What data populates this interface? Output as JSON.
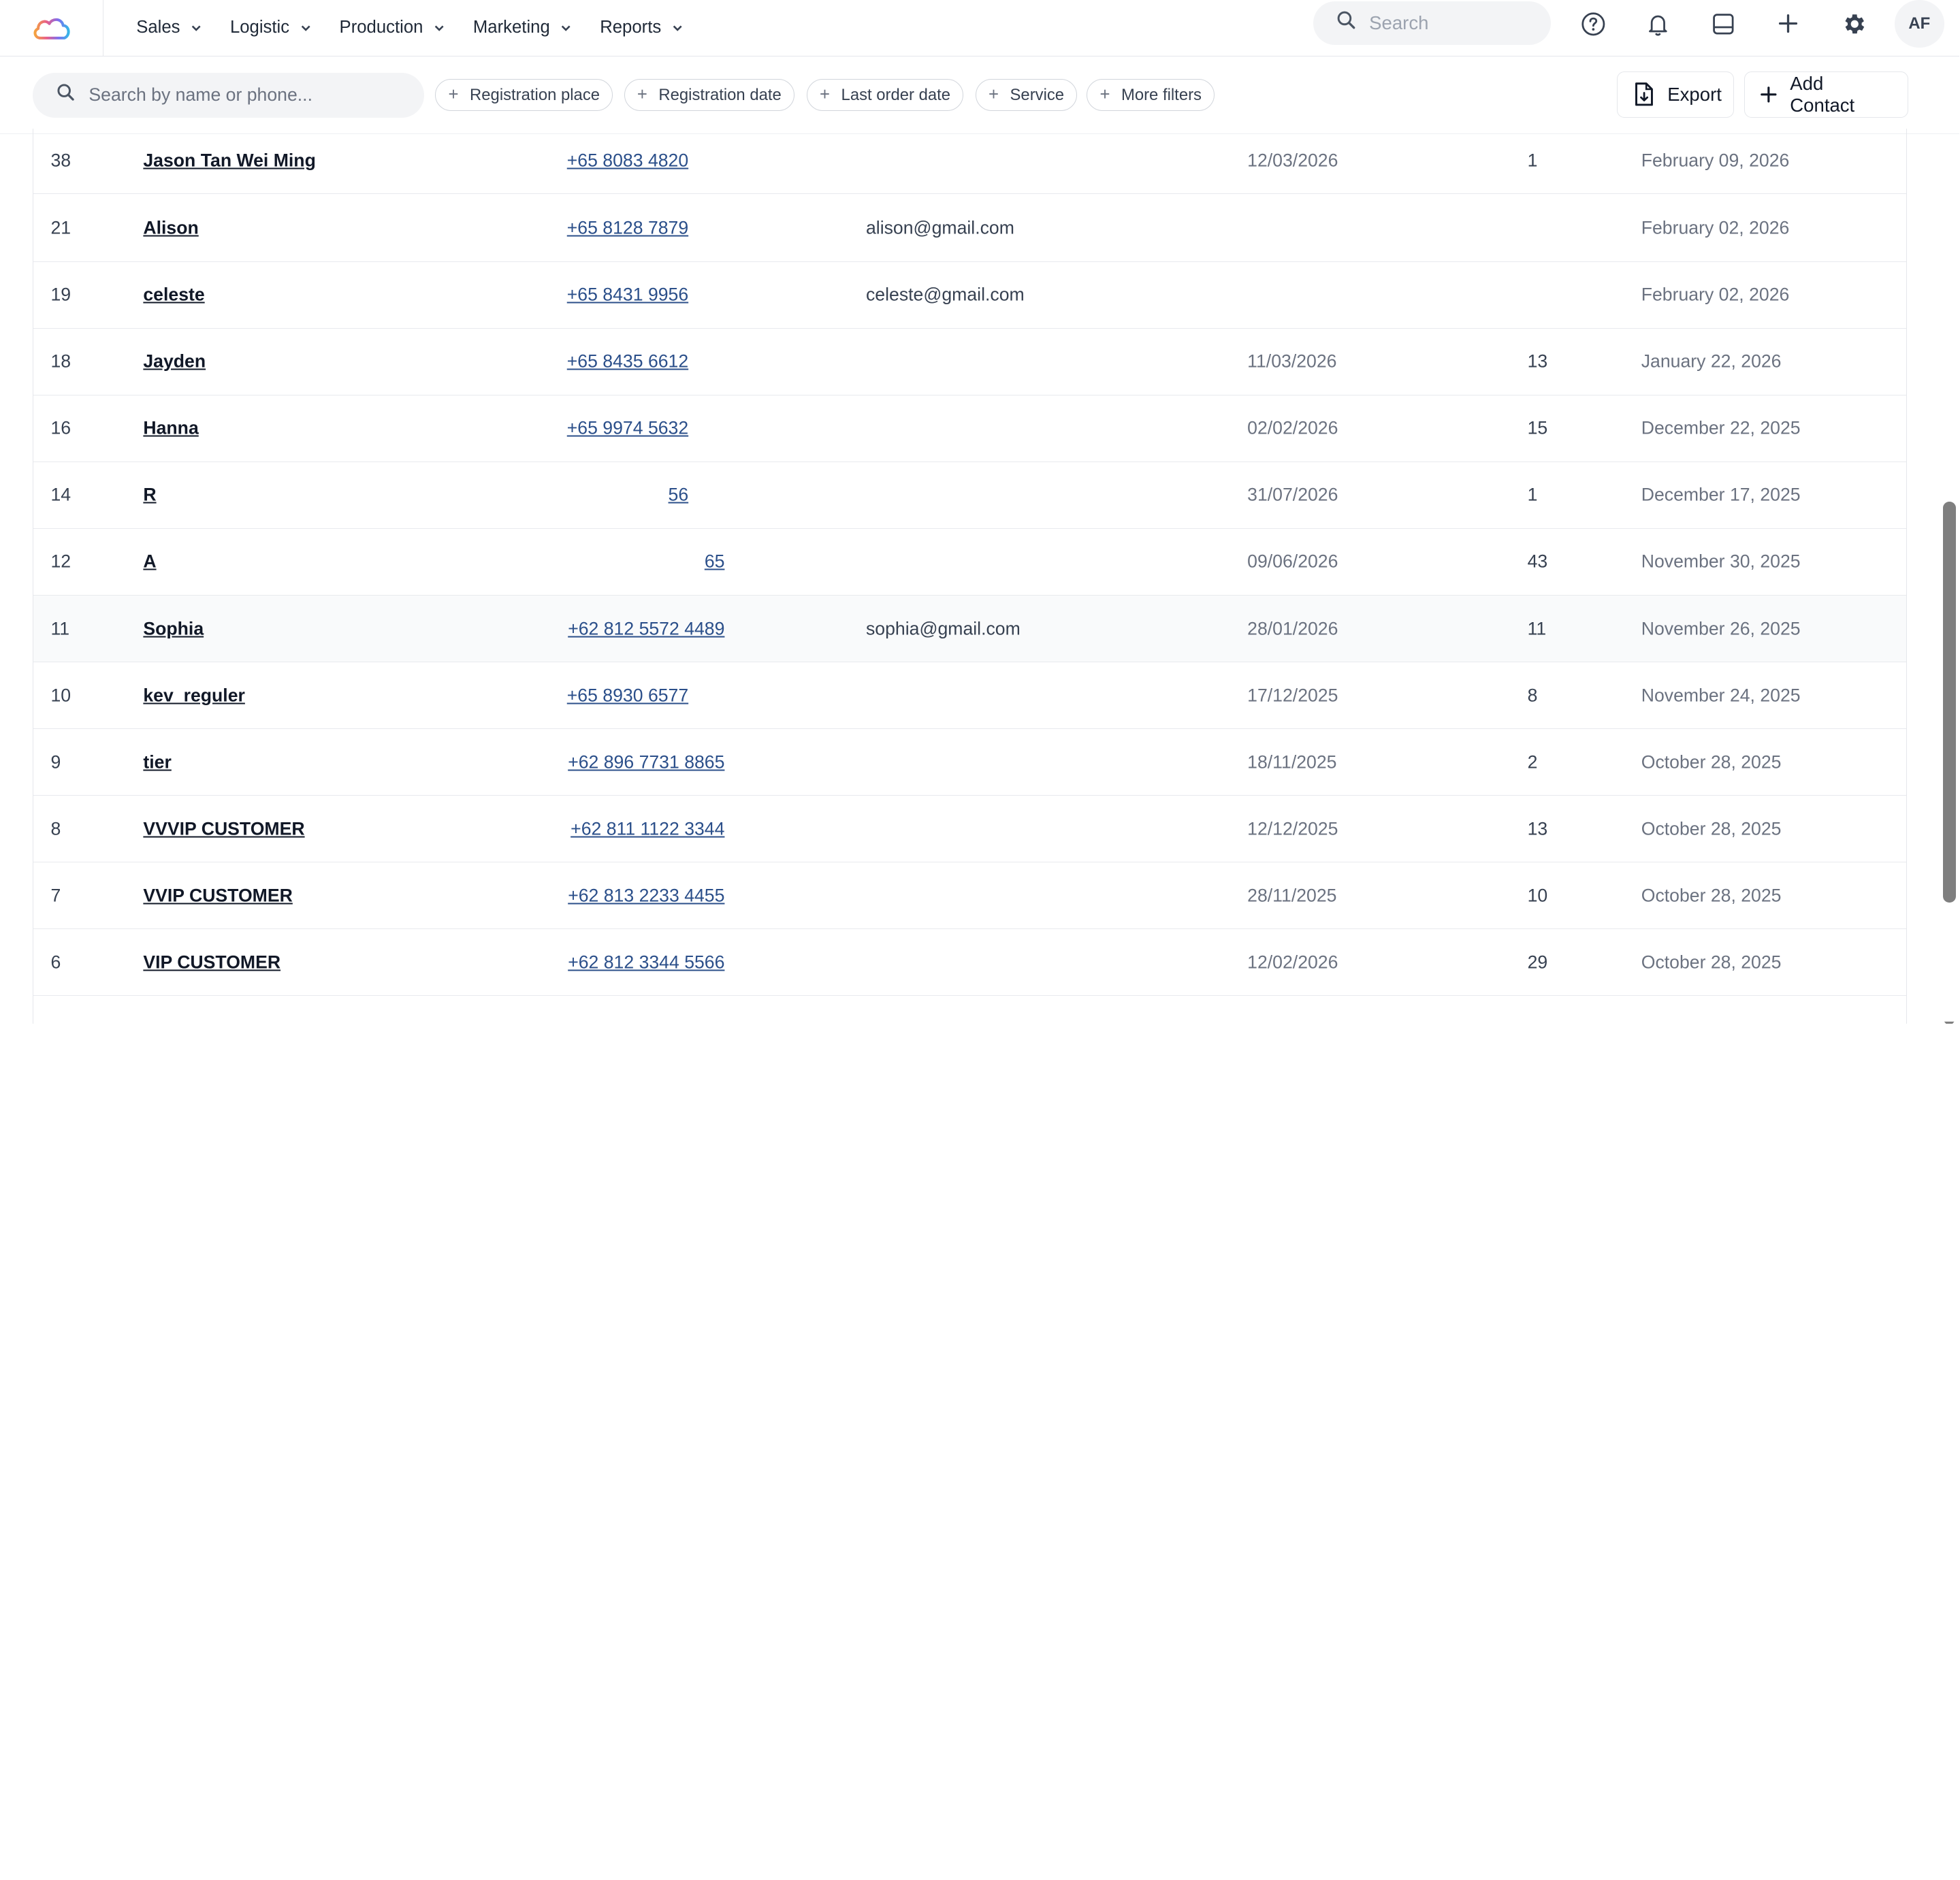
{
  "nav": {
    "menu": [
      {
        "label": "Sales"
      },
      {
        "label": "Logistic"
      },
      {
        "label": "Production"
      },
      {
        "label": "Marketing"
      },
      {
        "label": "Reports"
      }
    ],
    "search_placeholder": "Search",
    "avatar_initials": "AF"
  },
  "filters": {
    "search_placeholder": "Search by name or phone...",
    "chips": [
      {
        "label": "Registration place"
      },
      {
        "label": "Registration date"
      },
      {
        "label": "Last order date"
      },
      {
        "label": "Service"
      },
      {
        "label": "More filters"
      }
    ],
    "export_label": "Export",
    "add_contact_label": "Add Contact"
  },
  "rows": [
    {
      "id": "38",
      "name": "Jason Tan Wei Ming",
      "phone": "+65 8083 4820",
      "email": "",
      "last_order": "12/03/2026",
      "orders": "1",
      "registered": "February 09, 2026"
    },
    {
      "id": "21",
      "name": "Alison",
      "phone": "+65 8128 7879",
      "email": "alison@gmail.com",
      "last_order": "",
      "orders": "",
      "registered": "February 02, 2026"
    },
    {
      "id": "19",
      "name": "celeste",
      "phone": "+65 8431 9956",
      "email": "celeste@gmail.com",
      "last_order": "",
      "orders": "",
      "registered": "February 02, 2026"
    },
    {
      "id": "18",
      "name": "Jayden",
      "phone": "+65 8435 6612",
      "email": "",
      "last_order": "11/03/2026",
      "orders": "13",
      "registered": "January 22, 2026"
    },
    {
      "id": "16",
      "name": "Hanna",
      "phone": "+65 9974 5632",
      "email": "",
      "last_order": "02/02/2026",
      "orders": "15",
      "registered": "December 22, 2025"
    },
    {
      "id": "14",
      "name": "R",
      "phone": "56",
      "email": "",
      "last_order": "31/07/2026",
      "orders": "1",
      "registered": "December 17, 2025"
    },
    {
      "id": "12",
      "name": "A",
      "phone": "65",
      "email": "",
      "last_order": "09/06/2026",
      "orders": "43",
      "registered": "November 30, 2025"
    },
    {
      "id": "11",
      "name": "Sophia",
      "phone": "+62 812 5572 4489",
      "email": "sophia@gmail.com",
      "last_order": "28/01/2026",
      "orders": "11",
      "registered": "November 26, 2025"
    },
    {
      "id": "10",
      "name": "kev_reguler",
      "phone": "+65 8930 6577",
      "email": "",
      "last_order": "17/12/2025",
      "orders": "8",
      "registered": "November 24, 2025"
    },
    {
      "id": "9",
      "name": "tier",
      "phone": "+62 896 7731 8865",
      "email": "",
      "last_order": "18/11/2025",
      "orders": "2",
      "registered": "October 28, 2025"
    },
    {
      "id": "8",
      "name": "VVVIP CUSTOMER",
      "phone": "+62 811 1122 3344",
      "email": "",
      "last_order": "12/12/2025",
      "orders": "13",
      "registered": "October 28, 2025"
    },
    {
      "id": "7",
      "name": "VVIP CUSTOMER",
      "phone": "+62 813 2233 4455",
      "email": "",
      "last_order": "28/11/2025",
      "orders": "10",
      "registered": "October 28, 2025"
    },
    {
      "id": "6",
      "name": "VIP CUSTOMER",
      "phone": "+62 812 3344 5566",
      "email": "",
      "last_order": "12/02/2026",
      "orders": "29",
      "registered": "October 28, 2025"
    }
  ]
}
